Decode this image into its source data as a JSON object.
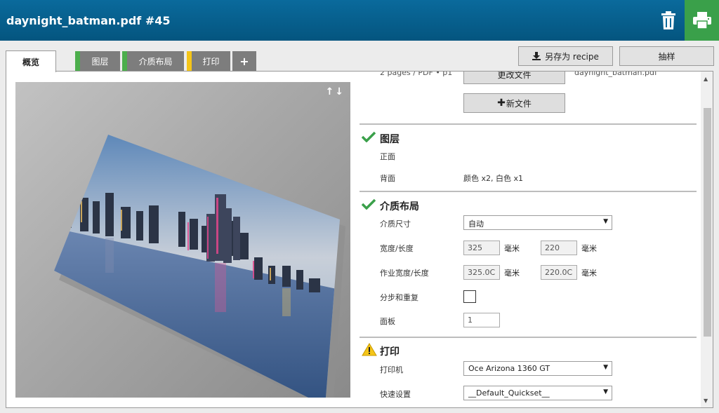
{
  "header": {
    "title": "daynight_batman.pdf #45",
    "delete_icon": "trash-icon",
    "print_icon": "printer-icon",
    "print_color": "#3aa04a"
  },
  "tabs": [
    {
      "label": "概览",
      "active": true
    },
    {
      "label": "图层",
      "status": "green"
    },
    {
      "label": "介质布局",
      "status": "green"
    },
    {
      "label": "打印",
      "status": "yellow"
    },
    {
      "label": "+"
    }
  ],
  "top_buttons": {
    "save_recipe": "另存为 recipe",
    "sample": "抽样"
  },
  "file": {
    "info_partial": "2 pages / PDF • p1",
    "change_file": "更改文件",
    "file_name_partial": "daynight_batman.pdf",
    "new_file": "新文件"
  },
  "layers": {
    "title": "图层",
    "front_label": "正面",
    "back_label": "背面",
    "back_value": "颜色 x2, 白色 x1"
  },
  "media": {
    "title": "介质布局",
    "size_label": "介质尺寸",
    "size_value": "自动",
    "width_length_label": "宽度/长度",
    "width": "325",
    "length": "220",
    "unit": "毫米",
    "job_width_length_label": "作业宽度/长度",
    "job_width": "325.0C",
    "job_length": "220.0C",
    "step_repeat_label": "分步和重复",
    "panels_label": "面板",
    "panels": "1"
  },
  "print": {
    "title": "打印",
    "printer_label": "打印机",
    "printer_value": "Oce Arizona 1360 GT",
    "quickset_label": "快速设置",
    "quickset_value": "__Default_Quickset__"
  },
  "preview": {
    "arrows": "↑↓"
  }
}
